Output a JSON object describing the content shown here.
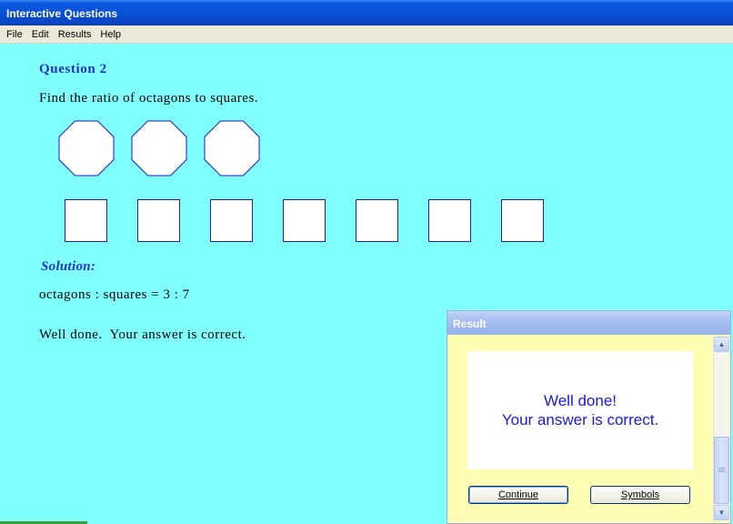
{
  "window": {
    "title": "Interactive Questions"
  },
  "menu": [
    "File",
    "Edit",
    "Results",
    "Help"
  ],
  "question": {
    "title": "Question 2",
    "text": "Find the ratio of octagons to squares.",
    "octagon_count": 3,
    "square_count": 7
  },
  "solution": {
    "title": "Solution:",
    "text": "octagons : squares = 3 : 7",
    "feedback": "Well done.  Your answer is correct."
  },
  "result_dialog": {
    "title": "Result",
    "message_line1": "Well done!",
    "message_line2": "Your answer is correct.",
    "continue_label": "Continue",
    "symbols_label": "Symbols"
  },
  "colors": {
    "background": "#80ffff",
    "heading": "#2233cc",
    "shape_stroke": "#1a1acc",
    "dialog_bg": "#fdfdb4",
    "message": "#1a1ad6"
  }
}
